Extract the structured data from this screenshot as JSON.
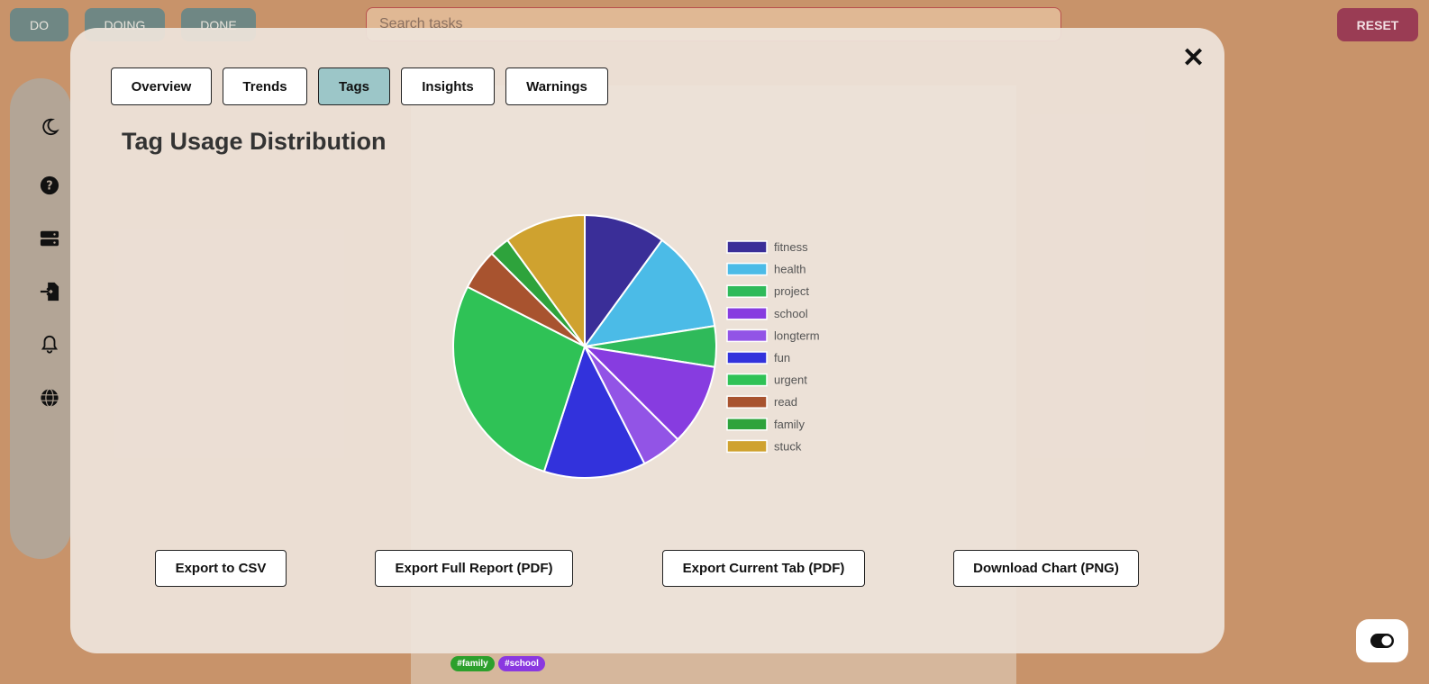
{
  "topbar": {
    "do_label": "DO",
    "doing_label": "DOING",
    "done_label": "DONE",
    "search_placeholder": "Search tasks",
    "reset_label": "RESET"
  },
  "sidebar": {
    "icons": [
      "moon-icon",
      "help-icon",
      "storage-icon",
      "import-icon",
      "bell-icon",
      "globe-icon"
    ]
  },
  "background_tags": [
    {
      "label": "#family",
      "color": "#2ca02c"
    },
    {
      "label": "#school",
      "color": "#8a38e0"
    }
  ],
  "modal": {
    "tabs": [
      "Overview",
      "Trends",
      "Tags",
      "Insights",
      "Warnings"
    ],
    "active_tab": "Tags",
    "close_label": "✕",
    "exports": {
      "csv": "Export to CSV",
      "full_pdf": "Export Full Report (PDF)",
      "tab_pdf": "Export Current Tab (PDF)",
      "png": "Download Chart (PNG)"
    }
  },
  "chart_data": {
    "type": "pie",
    "title": "Tag Usage Distribution",
    "legend_position": "right",
    "categories": [
      "fitness",
      "health",
      "project",
      "school",
      "longterm",
      "fun",
      "urgent",
      "read",
      "family",
      "stuck"
    ],
    "values": [
      4,
      5,
      2,
      4,
      2,
      5,
      11,
      2,
      1,
      4
    ],
    "colors": [
      "#3a2e98",
      "#4bbbe7",
      "#2fba5a",
      "#873ce0",
      "#9254e6",
      "#3232dc",
      "#2fc256",
      "#a8532f",
      "#2ea33c",
      "#cfa22f"
    ]
  }
}
